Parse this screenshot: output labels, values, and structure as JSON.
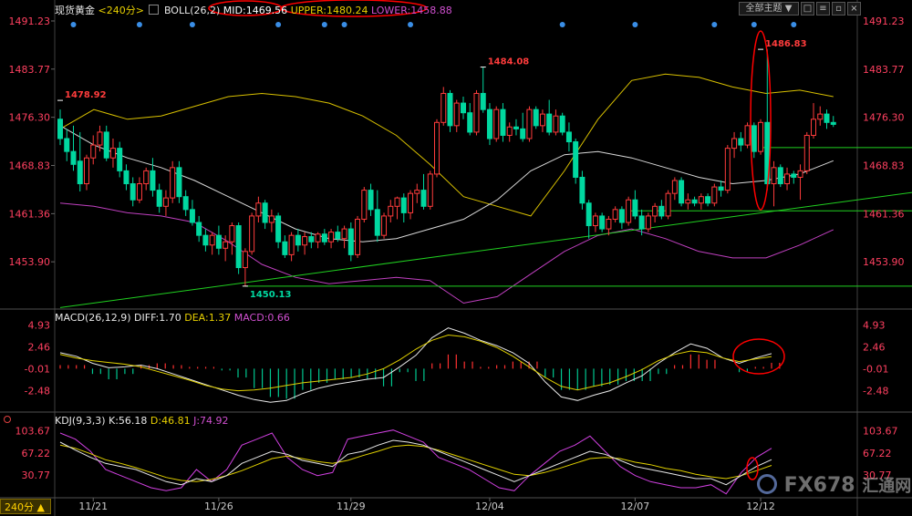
{
  "header": {
    "symbol": "现货黄金",
    "period": "<240分>",
    "indicator_name": "BOLL(26,2)",
    "mid": "MID:1469.56",
    "upper": "UPPER:1480.24",
    "lower": "LOWER:1458.88",
    "theme_button": "全部主题",
    "period_selector": "240分"
  },
  "macd_header": {
    "name": "MACD(26,12,9)",
    "diff": "DIFF:1.70",
    "dea": "DEA:1.37",
    "macd": "MACD:0.66"
  },
  "kdj_header": {
    "name": "KDJ(9,3,3)",
    "k": "K:56.18",
    "d": "D:46.81",
    "j": "J:74.92"
  },
  "watermark": {
    "brand": "FX678",
    "suffix": "汇通网"
  },
  "colors": {
    "up": "#ff3c3c",
    "down": "#00d8a0",
    "mid": "#d8d8d8",
    "upper": "#d8c000",
    "lower": "#c040c0",
    "trend": "#20d020",
    "price_axis": "#ff4060",
    "dea": "#e0d000",
    "diff": "#e8e8e8",
    "macd_pos": "#ff3030",
    "macd_neg": "#00c890",
    "j": "#d040e0",
    "annotation": "#ff0000"
  },
  "chart_data": [
    {
      "type": "candlestick",
      "title": "现货黄金 240分 BOLL(26,2)",
      "ylim": [
        1447.0,
        1492.5
      ],
      "y_ticks": [
        "1491.23",
        "1483.77",
        "1476.30",
        "1468.83",
        "1461.36",
        "1453.90"
      ],
      "x_ticks": [
        "11/21",
        "11/26",
        "11/29",
        "12/04",
        "12/07",
        "12/12"
      ],
      "x_tick_bar_index": [
        5,
        24,
        44,
        65,
        87,
        106
      ],
      "ohlc": [
        [
          1476.0,
          1477.5,
          1472.0,
          1473.0
        ],
        [
          1473.0,
          1474.5,
          1469.5,
          1471.0
        ],
        [
          1471.0,
          1475.0,
          1468.0,
          1469.0
        ],
        [
          1469.5,
          1474.0,
          1464.8,
          1466.0
        ],
        [
          1466.0,
          1470.5,
          1465.0,
          1470.0
        ],
        [
          1470.0,
          1473.5,
          1469.0,
          1472.0
        ],
        [
          1472.0,
          1475.0,
          1471.0,
          1474.0
        ],
        [
          1474.0,
          1475.0,
          1469.5,
          1470.0
        ],
        [
          1470.0,
          1473.0,
          1468.5,
          1471.5
        ],
        [
          1471.5,
          1472.5,
          1467.0,
          1468.0
        ],
        [
          1468.0,
          1469.0,
          1465.0,
          1466.0
        ],
        [
          1466.0,
          1467.0,
          1462.5,
          1463.5
        ],
        [
          1463.5,
          1467.0,
          1463.0,
          1466.0
        ],
        [
          1466.0,
          1468.5,
          1465.0,
          1468.0
        ],
        [
          1468.0,
          1470.0,
          1464.0,
          1465.0
        ],
        [
          1465.0,
          1466.0,
          1461.5,
          1462.5
        ],
        [
          1462.5,
          1465.0,
          1461.0,
          1463.8
        ],
        [
          1463.8,
          1469.5,
          1463.0,
          1468.5
        ],
        [
          1468.5,
          1469.5,
          1463.0,
          1464.0
        ],
        [
          1464.0,
          1465.0,
          1461.0,
          1462.0
        ],
        [
          1462.0,
          1463.5,
          1459.5,
          1460.0
        ],
        [
          1460.0,
          1461.0,
          1457.0,
          1458.0
        ],
        [
          1458.0,
          1459.0,
          1455.5,
          1456.5
        ],
        [
          1456.5,
          1458.5,
          1455.0,
          1458.0
        ],
        [
          1458.0,
          1459.5,
          1455.0,
          1456.0
        ],
        [
          1456.0,
          1458.0,
          1454.0,
          1457.0
        ],
        [
          1457.0,
          1460.0,
          1455.0,
          1459.5
        ],
        [
          1459.5,
          1460.0,
          1452.0,
          1453.0
        ],
        [
          1453.0,
          1456.0,
          1450.13,
          1455.5
        ],
        [
          1455.5,
          1461.5,
          1455.0,
          1461.0
        ],
        [
          1461.0,
          1464.0,
          1460.0,
          1463.0
        ],
        [
          1463.0,
          1463.5,
          1459.0,
          1460.0
        ],
        [
          1460.0,
          1462.0,
          1458.5,
          1461.0
        ],
        [
          1461.0,
          1461.5,
          1456.0,
          1457.0
        ],
        [
          1457.0,
          1458.0,
          1454.5,
          1455.0
        ],
        [
          1455.0,
          1458.5,
          1454.0,
          1458.0
        ],
        [
          1458.0,
          1459.0,
          1455.5,
          1456.5
        ],
        [
          1456.5,
          1458.5,
          1455.0,
          1457.8
        ],
        [
          1457.8,
          1458.5,
          1456.0,
          1457.0
        ],
        [
          1457.0,
          1458.5,
          1456.0,
          1458.2
        ],
        [
          1458.2,
          1459.0,
          1456.5,
          1457.0
        ],
        [
          1457.0,
          1459.0,
          1456.0,
          1458.5
        ],
        [
          1458.5,
          1459.5,
          1457.0,
          1457.5
        ],
        [
          1457.5,
          1459.5,
          1456.0,
          1459.0
        ],
        [
          1459.0,
          1460.0,
          1454.0,
          1455.0
        ],
        [
          1455.0,
          1461.0,
          1454.5,
          1460.5
        ],
        [
          1460.5,
          1465.5,
          1460.0,
          1465.0
        ],
        [
          1465.0,
          1466.0,
          1461.0,
          1462.0
        ],
        [
          1462.0,
          1465.0,
          1457.0,
          1458.0
        ],
        [
          1458.0,
          1461.5,
          1457.5,
          1461.0
        ],
        [
          1461.0,
          1463.5,
          1460.0,
          1462.5
        ],
        [
          1462.5,
          1464.0,
          1460.5,
          1463.8
        ],
        [
          1463.8,
          1464.5,
          1460.0,
          1461.5
        ],
        [
          1461.5,
          1465.0,
          1460.5,
          1464.5
        ],
        [
          1464.5,
          1466.0,
          1463.0,
          1465.0
        ],
        [
          1465.0,
          1467.5,
          1462.0,
          1462.5
        ],
        [
          1462.5,
          1468.0,
          1462.0,
          1467.5
        ],
        [
          1467.5,
          1476.0,
          1467.0,
          1475.5
        ],
        [
          1475.5,
          1481.0,
          1475.0,
          1480.0
        ],
        [
          1480.0,
          1480.5,
          1474.0,
          1475.0
        ],
        [
          1475.0,
          1479.0,
          1474.0,
          1478.5
        ],
        [
          1478.5,
          1479.5,
          1476.0,
          1477.0
        ],
        [
          1477.0,
          1478.5,
          1473.5,
          1474.0
        ],
        [
          1474.0,
          1480.5,
          1473.5,
          1480.0
        ],
        [
          1480.0,
          1484.08,
          1477.0,
          1477.5
        ],
        [
          1477.5,
          1478.5,
          1472.0,
          1473.0
        ],
        [
          1473.0,
          1478.0,
          1472.5,
          1477.5
        ],
        [
          1477.5,
          1478.5,
          1472.5,
          1473.5
        ],
        [
          1473.5,
          1475.5,
          1472.5,
          1474.8
        ],
        [
          1474.8,
          1476.0,
          1473.5,
          1474.5
        ],
        [
          1474.5,
          1477.0,
          1472.5,
          1473.0
        ],
        [
          1473.0,
          1478.0,
          1472.5,
          1477.5
        ],
        [
          1477.5,
          1478.0,
          1474.5,
          1475.0
        ],
        [
          1475.0,
          1477.5,
          1474.0,
          1476.8
        ],
        [
          1476.8,
          1479.0,
          1473.5,
          1474.0
        ],
        [
          1474.0,
          1477.5,
          1473.5,
          1476.5
        ],
        [
          1476.5,
          1477.0,
          1473.5,
          1474.0
        ],
        [
          1474.0,
          1475.5,
          1471.0,
          1472.5
        ],
        [
          1472.5,
          1473.0,
          1466.0,
          1467.0
        ],
        [
          1467.0,
          1468.0,
          1462.0,
          1463.0
        ],
        [
          1463.0,
          1463.5,
          1457.5,
          1459.5
        ],
        [
          1459.5,
          1461.5,
          1458.5,
          1461.0
        ],
        [
          1461.0,
          1461.5,
          1458.5,
          1459.0
        ],
        [
          1459.0,
          1461.0,
          1458.0,
          1460.5
        ],
        [
          1460.5,
          1462.5,
          1460.0,
          1462.0
        ],
        [
          1462.0,
          1462.5,
          1459.0,
          1460.0
        ],
        [
          1460.0,
          1464.0,
          1459.5,
          1463.5
        ],
        [
          1463.5,
          1465.0,
          1460.5,
          1461.0
        ],
        [
          1461.0,
          1462.0,
          1458.0,
          1459.0
        ],
        [
          1459.0,
          1461.5,
          1458.5,
          1461.0
        ],
        [
          1461.0,
          1463.0,
          1460.0,
          1462.5
        ],
        [
          1462.5,
          1463.5,
          1460.5,
          1461.0
        ],
        [
          1461.0,
          1465.0,
          1460.5,
          1464.5
        ],
        [
          1464.5,
          1467.0,
          1463.5,
          1466.5
        ],
        [
          1466.5,
          1467.0,
          1462.5,
          1463.0
        ],
        [
          1463.0,
          1464.5,
          1462.0,
          1463.5
        ],
        [
          1463.5,
          1464.0,
          1462.5,
          1463.0
        ],
        [
          1463.0,
          1464.5,
          1462.0,
          1464.0
        ],
        [
          1464.0,
          1464.5,
          1462.5,
          1463.0
        ],
        [
          1463.0,
          1466.0,
          1462.5,
          1465.5
        ],
        [
          1465.5,
          1466.5,
          1464.0,
          1465.0
        ],
        [
          1465.0,
          1472.0,
          1464.5,
          1471.5
        ],
        [
          1471.5,
          1474.0,
          1470.0,
          1473.0
        ],
        [
          1473.0,
          1474.0,
          1471.0,
          1472.0
        ],
        [
          1472.0,
          1475.5,
          1471.5,
          1475.0
        ],
        [
          1475.0,
          1475.5,
          1470.0,
          1471.0
        ],
        [
          1471.0,
          1476.0,
          1470.5,
          1475.5
        ],
        [
          1475.5,
          1486.83,
          1465.0,
          1466.0
        ],
        [
          1466.0,
          1469.5,
          1462.5,
          1468.5
        ],
        [
          1468.5,
          1469.0,
          1465.5,
          1466.0
        ],
        [
          1466.0,
          1468.5,
          1465.0,
          1467.5
        ],
        [
          1467.5,
          1468.0,
          1466.0,
          1467.0
        ],
        [
          1467.0,
          1469.0,
          1463.5,
          1468.0
        ],
        [
          1468.0,
          1474.0,
          1467.5,
          1473.5
        ],
        [
          1473.5,
          1478.5,
          1473.0,
          1476.0
        ],
        [
          1476.0,
          1478.0,
          1475.0,
          1476.8
        ],
        [
          1476.8,
          1477.5,
          1474.5,
          1475.5
        ],
        [
          1475.5,
          1476.5,
          1474.8,
          1475.2
        ]
      ],
      "boll_upper": [
        1474.5,
        1477.5,
        1476.0,
        1476.5,
        1478.0,
        1479.5,
        1480.0,
        1479.5,
        1478.5,
        1476.5,
        1473.5,
        1469.0,
        1464.0,
        1462.5,
        1461.0,
        1468.0,
        1476.0,
        1482.0,
        1483.0,
        1482.5,
        1481.0,
        1480.0,
        1480.5,
        1479.5
      ],
      "boll_mid": [
        1475.0,
        1472.0,
        1470.0,
        1468.5,
        1466.5,
        1464.0,
        1461.5,
        1459.0,
        1457.5,
        1457.0,
        1457.5,
        1459.0,
        1460.5,
        1463.5,
        1468.0,
        1470.5,
        1471.0,
        1470.0,
        1468.5,
        1467.0,
        1466.0,
        1466.5,
        1467.5,
        1469.56
      ],
      "boll_lower": [
        1463.0,
        1462.5,
        1461.5,
        1461.0,
        1460.0,
        1457.0,
        1453.5,
        1451.5,
        1450.5,
        1451.0,
        1451.5,
        1451.0,
        1447.5,
        1448.5,
        1452.0,
        1455.5,
        1458.0,
        1459.0,
        1457.5,
        1455.5,
        1454.5,
        1454.5,
        1456.5,
        1458.88
      ],
      "trendlines": [
        {
          "from": [
            0,
            1446.8
          ],
          "to": [
            119,
            1465.0
          ],
          "color": "trend"
        },
        {
          "from": [
            28,
            1450.13
          ],
          "to": [
            119,
            1450.13
          ],
          "color": "trend"
        },
        {
          "from": [
            86,
            1461.8
          ],
          "to": [
            119,
            1461.8
          ],
          "color": "trend"
        },
        {
          "from": [
            106,
            1471.6
          ],
          "to": [
            119,
            1471.6
          ],
          "color": "trend"
        }
      ],
      "annotations": [
        {
          "text": "1478.92",
          "bar": 0,
          "price": 1478.92,
          "color": "up"
        },
        {
          "text": "1484.08",
          "bar": 64,
          "price": 1484.08,
          "color": "up"
        },
        {
          "text": "1486.83",
          "bar": 106,
          "price": 1486.83,
          "color": "up"
        },
        {
          "text": "1450.13",
          "bar": 28,
          "price": 1450.13,
          "color": "down"
        }
      ],
      "marker_bars": [
        2,
        12,
        20,
        33,
        40,
        43,
        53,
        76,
        87,
        99,
        105,
        111
      ]
    },
    {
      "type": "bar",
      "title": "MACD(26,12,9)",
      "ylim": [
        -4.7,
        5.6
      ],
      "y_ticks": [
        "4.93",
        "2.46",
        "-0.01",
        "-2.48"
      ],
      "diff": [
        1.8,
        1.4,
        0.6,
        0.1,
        0.2,
        0.4,
        0.0,
        -0.6,
        -1.2,
        -1.8,
        -2.4,
        -3.0,
        -3.5,
        -3.8,
        -3.6,
        -2.8,
        -2.2,
        -1.8,
        -1.5,
        -1.2,
        -1.0,
        0.2,
        1.5,
        3.5,
        4.6,
        4.0,
        3.2,
        2.6,
        1.8,
        0.6,
        -1.5,
        -3.2,
        -3.6,
        -3.0,
        -2.5,
        -1.6,
        -0.8,
        0.6,
        1.8,
        2.8,
        2.3,
        1.2,
        0.6,
        1.2,
        1.7
      ],
      "dea": [
        1.6,
        1.2,
        0.9,
        0.7,
        0.5,
        0.2,
        -0.3,
        -0.8,
        -1.3,
        -1.9,
        -2.3,
        -2.5,
        -2.4,
        -2.2,
        -1.9,
        -1.6,
        -1.4,
        -1.2,
        -1.0,
        -0.6,
        0.0,
        1.0,
        2.2,
        3.2,
        3.8,
        3.6,
        3.1,
        2.4,
        1.4,
        0.2,
        -1.0,
        -2.0,
        -2.4,
        -2.0,
        -1.6,
        -0.9,
        -0.1,
        0.9,
        1.6,
        2.0,
        1.8,
        1.2,
        0.8,
        1.1,
        1.37
      ],
      "macd": [
        0.4,
        0.4,
        -0.6,
        -1.2,
        -0.6,
        0.4,
        0.6,
        0.4,
        0.2,
        0.2,
        -0.2,
        -1.0,
        -2.2,
        -3.2,
        -3.4,
        -2.4,
        -1.6,
        -1.2,
        -1.0,
        -1.2,
        -2.0,
        -0.4,
        -1.4,
        0.6,
        1.6,
        0.8,
        0.2,
        0.4,
        0.8,
        0.8,
        -1.0,
        -2.4,
        -2.4,
        -2.0,
        -1.8,
        -1.4,
        -1.4,
        -0.6,
        0.4,
        1.6,
        1.0,
        0.0,
        -0.4,
        0.2,
        0.66
      ]
    },
    {
      "type": "line",
      "title": "KDJ(9,3,3)",
      "ylim": [
        -5,
        115
      ],
      "y_ticks": [
        "103.67",
        "67.22",
        "30.77"
      ],
      "k": [
        85,
        72,
        60,
        50,
        45,
        40,
        30,
        20,
        15,
        25,
        20,
        30,
        50,
        60,
        70,
        65,
        55,
        50,
        45,
        65,
        70,
        80,
        88,
        85,
        80,
        70,
        60,
        50,
        40,
        30,
        20,
        30,
        40,
        50,
        60,
        70,
        65,
        55,
        45,
        40,
        35,
        30,
        25,
        25,
        15,
        30,
        45,
        56.18
      ],
      "d": [
        80,
        75,
        66,
        56,
        50,
        43,
        35,
        27,
        22,
        20,
        24,
        30,
        38,
        48,
        58,
        62,
        58,
        53,
        50,
        55,
        63,
        70,
        78,
        80,
        78,
        72,
        64,
        56,
        48,
        40,
        32,
        30,
        35,
        42,
        50,
        58,
        60,
        58,
        52,
        48,
        42,
        38,
        32,
        28,
        25,
        30,
        38,
        46.81
      ],
      "j": [
        100,
        90,
        70,
        40,
        30,
        20,
        10,
        5,
        10,
        40,
        20,
        40,
        80,
        90,
        100,
        60,
        40,
        30,
        35,
        90,
        95,
        100,
        105,
        95,
        85,
        60,
        50,
        40,
        25,
        10,
        5,
        30,
        50,
        70,
        80,
        95,
        70,
        45,
        30,
        20,
        15,
        10,
        10,
        15,
        0,
        35,
        60,
        74.92
      ]
    }
  ]
}
